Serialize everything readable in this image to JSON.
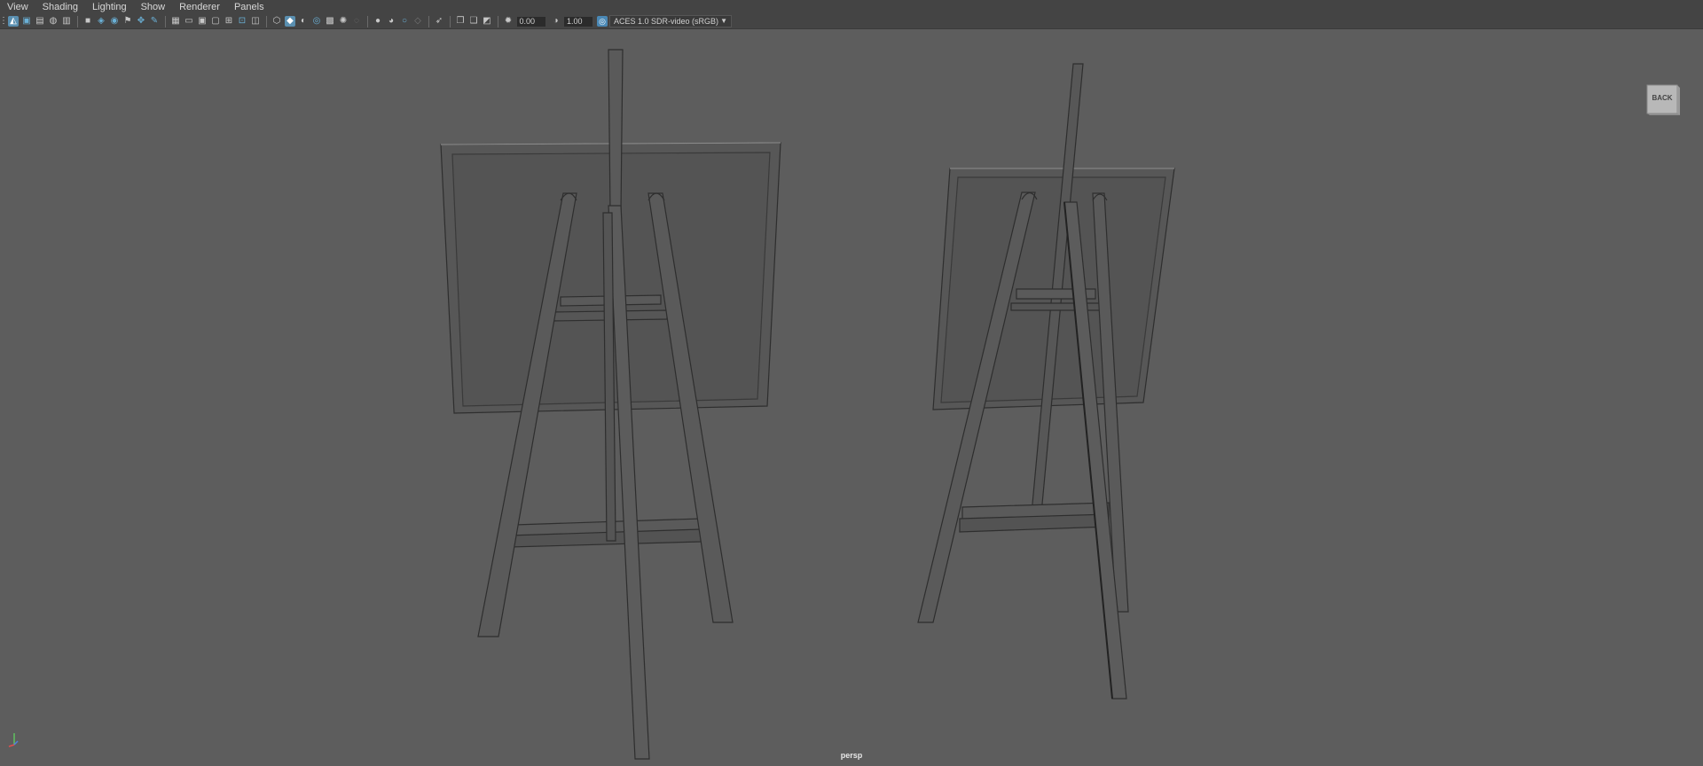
{
  "menu": {
    "items": [
      "View",
      "Shading",
      "Lighting",
      "Show",
      "Renderer",
      "Panels"
    ]
  },
  "toolbar": {
    "exposure_value": "0.00",
    "gamma_value": "1.00",
    "color_space": "ACES 1.0 SDR-video (sRGB)",
    "icons": [
      "select-camera-icon",
      "camera-attributes-icon",
      "bookmark-icon",
      "image-plane-icon",
      "grid-icon",
      "film-gate-icon",
      "resolution-gate-icon",
      "gate-mask-icon",
      "field-chart-icon",
      "safe-action-icon",
      "safe-title-icon",
      "wireframe-icon",
      "smooth-shade-icon",
      "flat-shade-icon",
      "bounding-box-icon",
      "textured-icon",
      "use-all-lights-icon",
      "shadows-icon",
      "ambient-occlusion-icon",
      "motion-blur-icon",
      "anti-aliasing-icon",
      "depth-of-field-icon",
      "isolate-select-icon",
      "xray-icon",
      "xray-joints-icon",
      "xray-components-icon"
    ]
  },
  "viewport": {
    "camera_name": "persp",
    "viewcube_face": "BACK",
    "background_color": "#5d5d5d",
    "accent_color": "#5a8fb0"
  }
}
